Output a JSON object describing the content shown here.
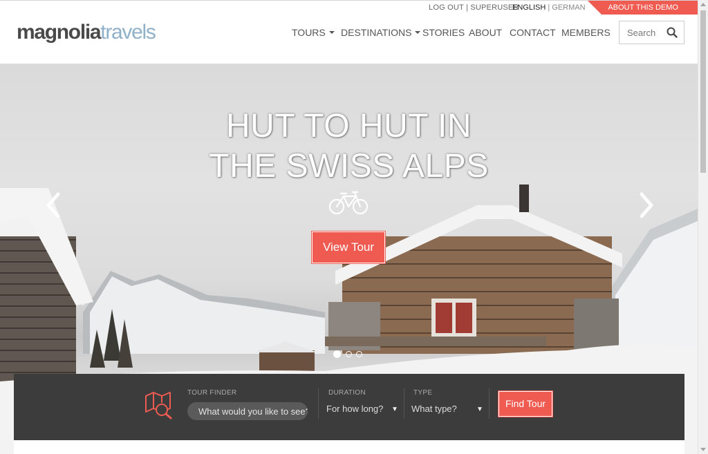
{
  "util_bar": {
    "logout": "LOG OUT",
    "separator": "|",
    "user": "SUPERUSER",
    "lang_active": "ENGLISH",
    "lang_sep": "|",
    "lang_other": "GERMAN",
    "about_demo": "ABOUT THIS DEMO"
  },
  "header": {
    "logo_part1": "magnolia",
    "logo_part2": "travels",
    "nav": [
      {
        "label": "TOURS",
        "dropdown": true
      },
      {
        "label": "DESTINATIONS",
        "dropdown": true
      },
      {
        "label": "STORIES",
        "dropdown": false
      },
      {
        "label": "ABOUT",
        "dropdown": false
      },
      {
        "label": "CONTACT",
        "dropdown": false
      },
      {
        "label": "MEMBERS",
        "dropdown": false
      }
    ],
    "search_placeholder": "Search",
    "search_icon": "magnifier-icon"
  },
  "hero": {
    "title_line1": "HUT TO HUT IN",
    "title_line2": "THE SWISS ALPS",
    "icon": "bicycle-icon",
    "button": "View Tour",
    "slides": 3,
    "active_slide": 1
  },
  "tour_finder": {
    "icon": "map-search-icon",
    "label": "TOUR FINDER",
    "placeholder": "What would you like to see?",
    "duration_label": "DURATION",
    "duration_value": "For how long?",
    "type_label": "TYPE",
    "type_value": "What type?",
    "button": "Find Tour"
  },
  "colors": {
    "accent": "#ef5b50",
    "finder_bg": "#3c3c3c",
    "logo_dark": "#4a4a4a",
    "logo_light": "#8fb0c9"
  }
}
